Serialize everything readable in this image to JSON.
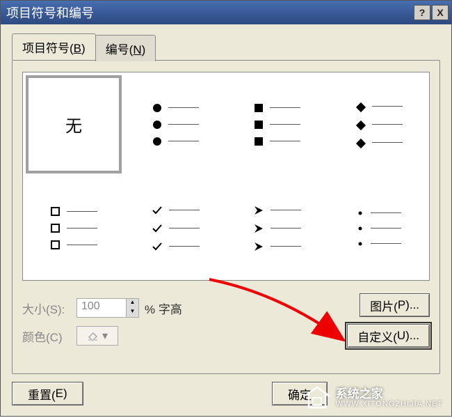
{
  "window": {
    "title": "项目符号和编号"
  },
  "titlebar_buttons": {
    "help": "?",
    "close": "X"
  },
  "tabs": {
    "bullets": {
      "label_pre": "项目符号(",
      "hotkey": "B",
      "label_post": ")"
    },
    "numbers": {
      "label_pre": "编号(",
      "hotkey": "N",
      "label_post": ")"
    }
  },
  "gallery": {
    "none": "无",
    "styles": [
      "none",
      "disc",
      "square",
      "diamond",
      "hollow-square",
      "check",
      "arrow",
      "dot"
    ],
    "selected_index": 0
  },
  "controls": {
    "size_label_pre": "大小(",
    "size_hotkey": "S",
    "size_label_post": "):",
    "size_value": "100",
    "size_unit": "% 字高",
    "color_label_pre": "颜色(",
    "color_hotkey": "C",
    "color_label_post": ")"
  },
  "buttons": {
    "picture_pre": "图片(",
    "picture_hotkey": "P",
    "picture_post": ")...",
    "custom_pre": "自定义(",
    "custom_hotkey": "U",
    "custom_post": ")...",
    "reset_pre": "重置(",
    "reset_hotkey": "E",
    "reset_post": ")",
    "ok": "确定"
  },
  "watermark": {
    "line1": "系统之家",
    "line2": "WWW.XITONGZHIJIA.NET"
  }
}
